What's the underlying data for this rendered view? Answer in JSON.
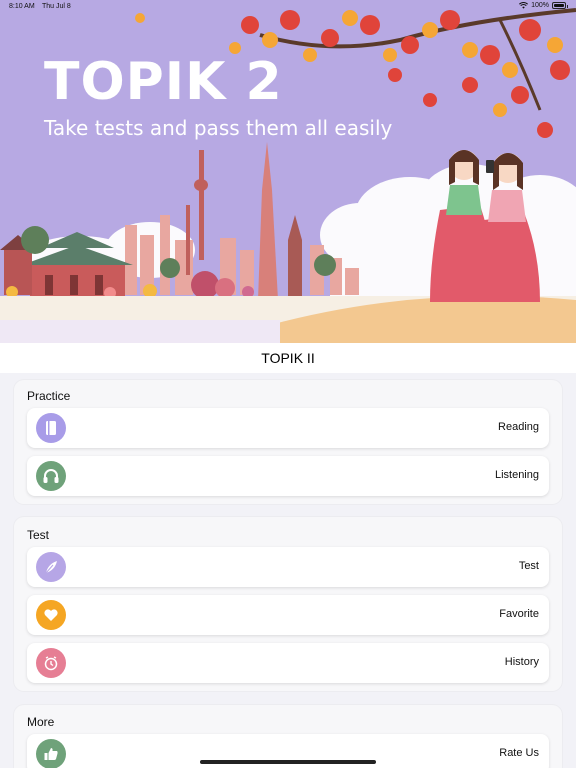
{
  "status_bar": {
    "time": "8:10 AM",
    "date": "Thu Jul 8",
    "battery": "100%"
  },
  "banner": {
    "title": "TOPIK 2",
    "subtitle": "Take tests and pass them all easily"
  },
  "nav": {
    "title": "TOPIK II"
  },
  "sections": [
    {
      "title": "Practice",
      "items": [
        {
          "label": "Reading",
          "icon": "book-icon",
          "color": "#a89ce8"
        },
        {
          "label": "Listening",
          "icon": "headphones-icon",
          "color": "#6fa27a"
        }
      ]
    },
    {
      "title": "Test",
      "items": [
        {
          "label": "Test",
          "icon": "feather-icon",
          "color": "#b6a6e6"
        },
        {
          "label": "Favorite",
          "icon": "heart-icon",
          "color": "#f5a623"
        },
        {
          "label": "History",
          "icon": "clock-icon",
          "color": "#e67e94"
        }
      ]
    },
    {
      "title": "More",
      "items": [
        {
          "label": "Rate Us",
          "icon": "thumbs-up-icon",
          "color": "#6fa27a"
        }
      ]
    }
  ],
  "colors": {
    "banner_bg": "#b7a9e3",
    "accent_purple": "#a89ce8",
    "accent_green": "#6fa27a",
    "accent_orange": "#f5a623",
    "accent_pink": "#e67e94"
  }
}
